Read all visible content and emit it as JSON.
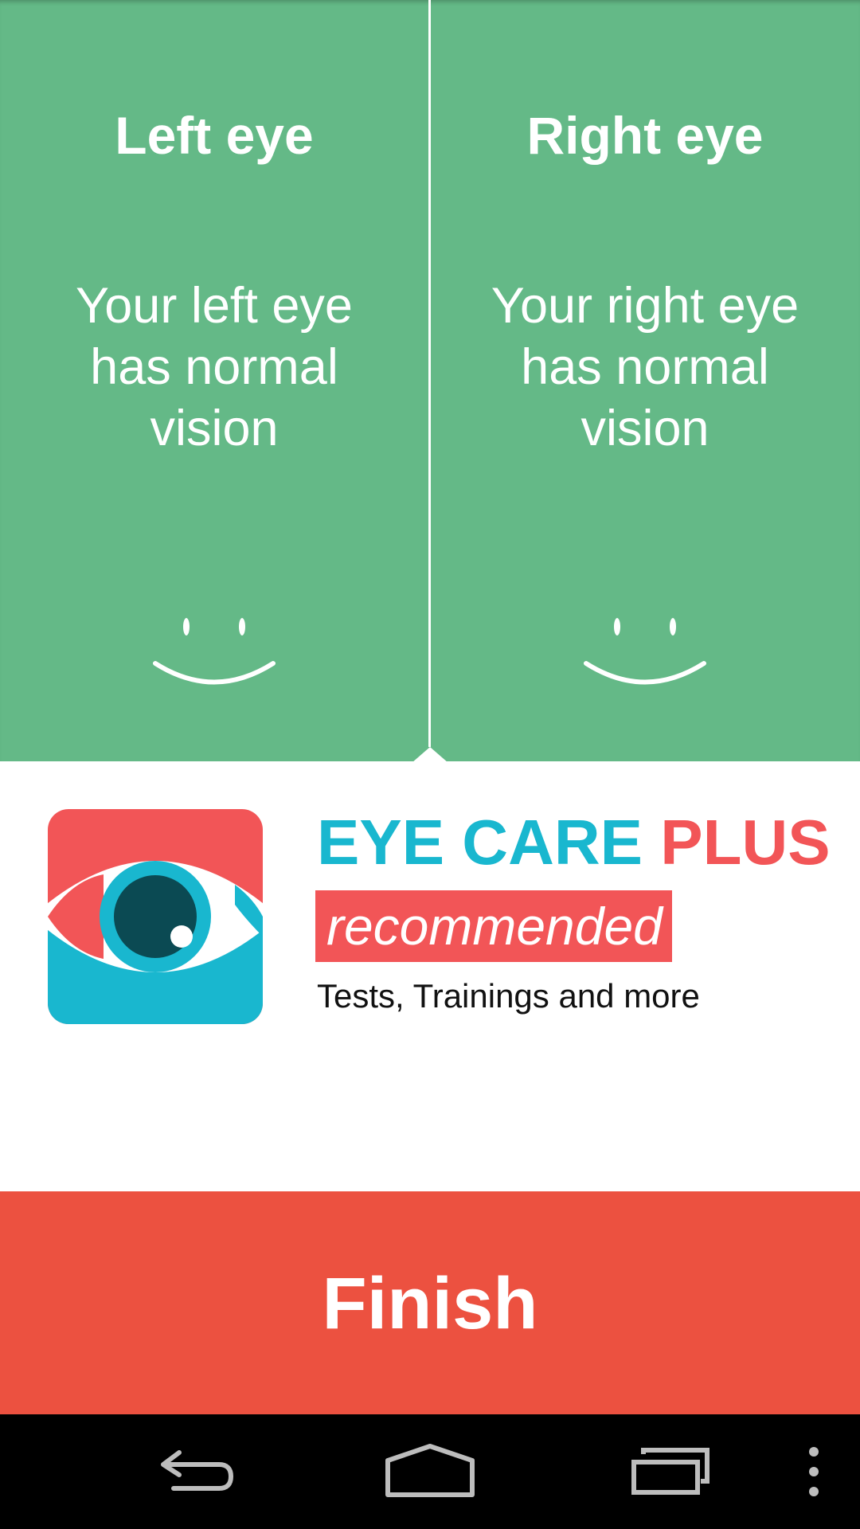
{
  "left_eye": {
    "title": "Left eye",
    "result": "Your left eye has normal vision",
    "status_icon": "smiley-icon"
  },
  "right_eye": {
    "title": "Right eye",
    "result": "Your right eye has normal vision",
    "status_icon": "smiley-icon"
  },
  "promo": {
    "app_name_part1": "EYE CARE",
    "app_name_part2": "PLUS",
    "badge": "recommended",
    "tagline": "Tests, Trainings and more",
    "logo_icon": "eye-logo-icon"
  },
  "finish_label": "Finish",
  "nav": {
    "back_icon": "back-icon",
    "home_icon": "home-icon",
    "recents_icon": "recents-icon",
    "menu_icon": "overflow-menu-icon"
  },
  "colors": {
    "results_bg": "#64b987",
    "finish_bg": "#ec5140",
    "accent_teal": "#19b7cf",
    "accent_red": "#f25557",
    "pupil": "#0b4a53"
  }
}
